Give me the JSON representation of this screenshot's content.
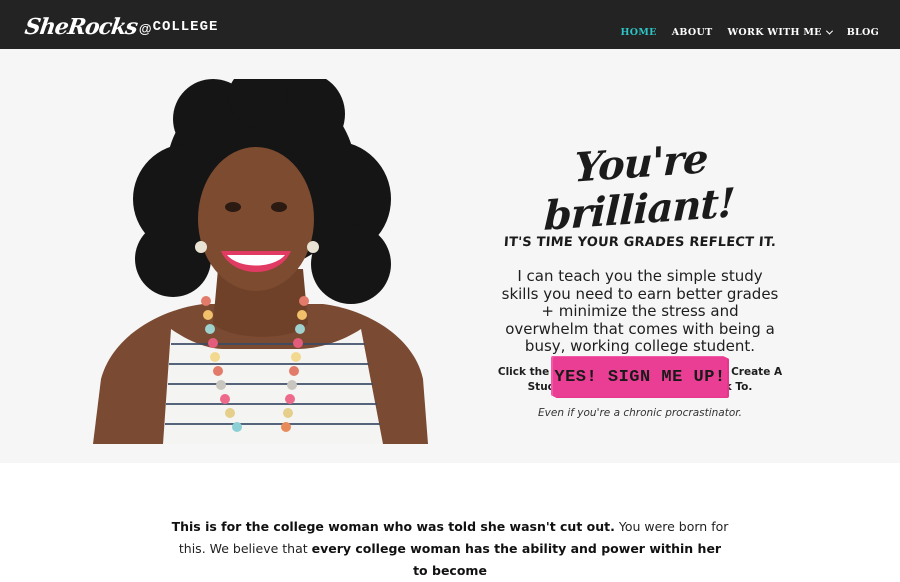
{
  "header": {
    "logo_script": "SheRocks",
    "logo_at": "@",
    "logo_college": "COLLEGE",
    "nav": [
      {
        "label": "HOME",
        "active": true
      },
      {
        "label": "ABOUT",
        "active": false
      },
      {
        "label": "WORK WITH ME",
        "active": false,
        "has_dropdown": true
      },
      {
        "label": "BLOG",
        "active": false
      }
    ]
  },
  "hero": {
    "headline": "You're brilliant!",
    "subhead": "IT'S TIME YOUR GRADES REFLECT IT.",
    "lead": "I can teach you the simple study skills you need to earn better grades + minimize the stress and overwhelm that comes with being a busy, working college student.",
    "cta_text": "Click the button below to learn How To Create A Study Routine You'll Actually Stick To.",
    "note": "Even if you're a chronic procrastinator.",
    "button_label": "YES! SIGN ME UP!"
  },
  "body": {
    "bold_1": "This is for the college woman who was told she wasn't cut out.",
    "text_1": " You were born for this. We believe that ",
    "bold_2": "every college woman has the ability and power within her to become"
  },
  "colors": {
    "topbar": "#232323",
    "accent_teal": "#2ec4c6",
    "button_pink": "#ea3e95",
    "hero_bg": "#f6f6f6"
  },
  "icons": [
    "chevron-down-icon"
  ]
}
